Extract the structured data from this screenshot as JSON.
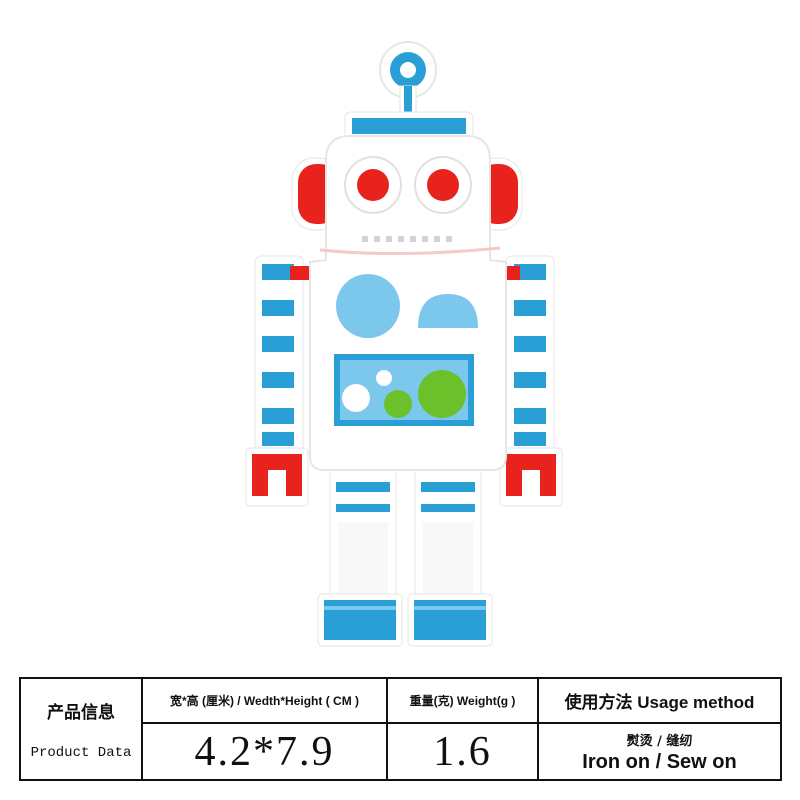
{
  "product_photo": {
    "subject": "embroidered robot patch",
    "colors": {
      "blue": "#2a9fd6",
      "light_blue": "#7cc8ec",
      "red": "#e8231d",
      "green": "#6cc02a",
      "white": "#ffffff"
    }
  },
  "spec_table": {
    "row_label_cn": "产品信息",
    "row_label_en": "Product Data",
    "size_header": "宽*高 (厘米) / Wedth*Height ( CM )",
    "size_value": "4.2*7.9",
    "weight_header": "重量(克) Weight(g )",
    "weight_value": "1.6",
    "usage_header": "使用方法 Usage method",
    "usage_cn": "熨烫 / 缝纫",
    "usage_en": "Iron on / Sew on"
  }
}
